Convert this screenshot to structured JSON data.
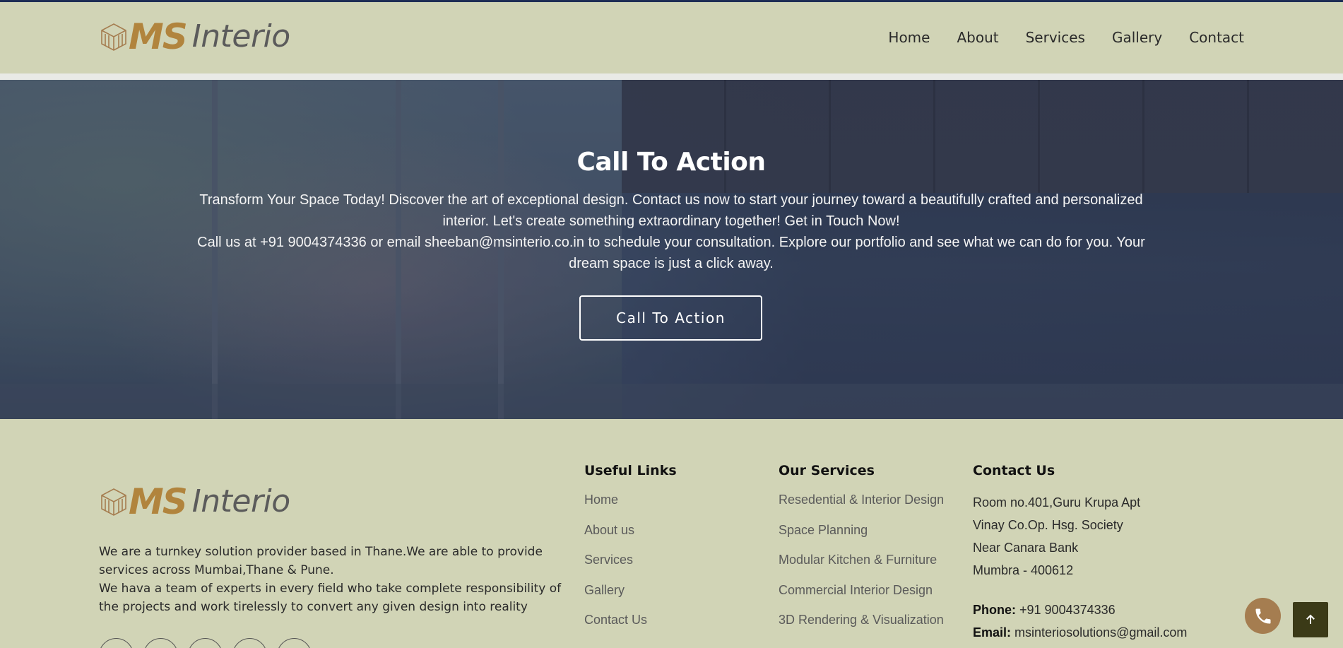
{
  "brand": {
    "logo_ms": "MS",
    "logo_word": "Interio",
    "accent": "#b1843d",
    "header_bg": "#d1d4b6"
  },
  "nav": {
    "items": [
      {
        "label": "Home"
      },
      {
        "label": "About"
      },
      {
        "label": "Services"
      },
      {
        "label": "Gallery"
      },
      {
        "label": "Contact"
      }
    ]
  },
  "hero": {
    "title": "Call To Action",
    "para1": "Transform Your Space Today! Discover the art of exceptional design. Contact us now to start your journey toward a beautifully crafted and personalized interior. Let's create something extraordinary together! Get in Touch Now!",
    "para2": "Call us at +91 9004374336 or email sheeban@msinterio.co.in to schedule your consultation. Explore our portfolio and see what we can do for you. Your dream space is just a click away.",
    "button_label": "Call To Action"
  },
  "footer": {
    "about_line1": "We are a turnkey solution provider based in Thane.We are able to provide services across Mumbai,Thane & Pune.",
    "about_line2": "We hava a team of experts in every field who take complete responsibility of the projects and work tirelessly to convert any given design into reality",
    "useful_links": {
      "heading": "Useful Links",
      "items": [
        "Home",
        "About us",
        "Services",
        "Gallery",
        "Contact Us"
      ]
    },
    "services": {
      "heading": "Our Services",
      "items": [
        "Resedential & Interior Design",
        "Space Planning",
        "Modular Kitchen & Furniture",
        "Commercial Interior Design",
        "3D Rendering & Visualization"
      ]
    },
    "contact": {
      "heading": "Contact Us",
      "address": [
        "Room no.401,Guru Krupa Apt",
        "Vinay Co.Op. Hsg. Society",
        "Near Canara Bank",
        "Mumbra - 400612"
      ],
      "phone_label": "Phone:",
      "phone": "+91 9004374336",
      "email_label": "Email:",
      "email": "msinteriosolutions@gmail.com"
    }
  },
  "icons": {
    "call": "phone-icon",
    "scroll_top": "arrow-up-icon",
    "logo_mark": "cube-lines-icon"
  }
}
